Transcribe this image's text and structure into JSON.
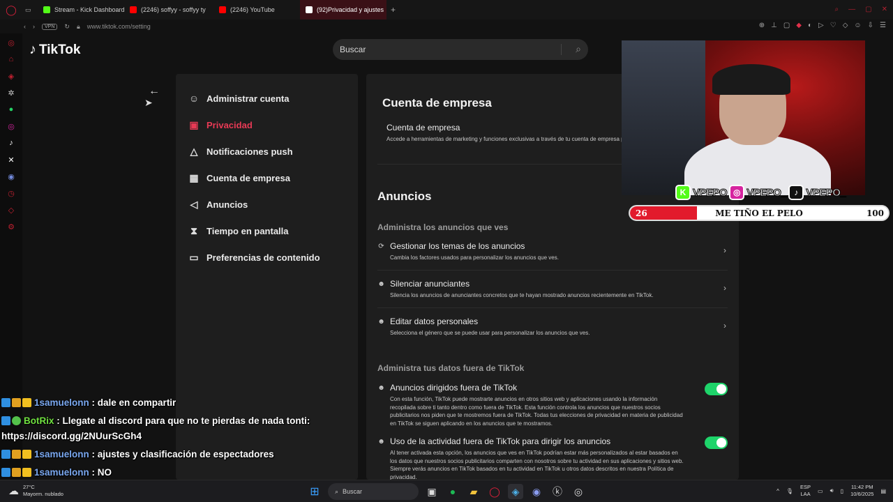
{
  "browser": {
    "tabs": [
      {
        "label": "Stream - Kick Dashboard",
        "color": "#53fc18",
        "active": false
      },
      {
        "label": "(2246) soffyy - soffyy ty",
        "color": "#ff0000",
        "active": false
      },
      {
        "label": "(2246) YouTube",
        "color": "#ff0000",
        "active": false
      },
      {
        "label": "(92)Privacidad y ajustes",
        "color": "#ffffff",
        "active": true
      }
    ],
    "new_tab": "+",
    "vpn_label": "VPN",
    "url": "www.tiktok.com/setting"
  },
  "tiktok": {
    "logo": "TikTok",
    "search_placeholder": "Buscar",
    "menu": [
      {
        "label": "Administrar cuenta",
        "icon": "user-icon",
        "glyph": "☺",
        "active": false
      },
      {
        "label": "Privacidad",
        "icon": "lock-icon",
        "glyph": "▣",
        "active": true
      },
      {
        "label": "Notificaciones push",
        "icon": "bell-icon",
        "glyph": "△",
        "active": false
      },
      {
        "label": "Cuenta de empresa",
        "icon": "store-icon",
        "glyph": "▦",
        "active": false
      },
      {
        "label": "Anuncios",
        "icon": "megaphone-icon",
        "glyph": "◁",
        "active": false
      },
      {
        "label": "Tiempo en pantalla",
        "icon": "hourglass-icon",
        "glyph": "⧗",
        "active": false
      },
      {
        "label": "Preferencias de contenido",
        "icon": "video-icon",
        "glyph": "▭",
        "active": false
      }
    ],
    "business": {
      "title": "Cuenta de empresa",
      "item_title": "Cuenta de empresa",
      "item_desc": "Accede a herramientas de marketing y funciones exclusivas a través de tu cuenta de empresa para conectar mejor con los espectadores."
    },
    "ads": {
      "title": "Anuncios",
      "section1": "Administra los anuncios que ves",
      "items": [
        {
          "title": "Gestionar los temas de los anuncios",
          "desc": "Cambia los factores usados para personalizar los anuncios que ves."
        },
        {
          "title": "Silenciar anunciantes",
          "desc": "Silencia los anuncios de anunciantes concretos que te hayan mostrado anuncios recientemente en TikTok."
        },
        {
          "title": "Editar datos personales",
          "desc": "Selecciona el género que se puede usar para personalizar los anuncios que ves."
        }
      ],
      "section2": "Administra tus datos fuera de TikTok",
      "toggles": [
        {
          "title": "Anuncios dirigidos fuera de TikTok",
          "desc": "Con esta función, TikTok puede mostrarte anuncios en otros sitios web y aplicaciones usando la información recopilada sobre ti tanto dentro como fuera de TikTok. Esta función controla los anuncios que nuestros socios publicitarios nos piden que te mostremos fuera de TikTok. Todas tus elecciones de privacidad en materia de publicidad en TikTok se siguen aplicando en los anuncios que te mostramos.",
          "on": true
        },
        {
          "title": "Uso de la actividad fuera de TikTok para dirigir los anuncios",
          "desc": "Al tener activada esta opción, los anuncios que ves en TikTok podrían estar más personalizados al estar basados en los datos que nuestros socios publicitarios comparten con nosotros sobre tu actividad en sus aplicaciones y sitios web. Siempre verás anuncios en TikTok basados en tu actividad en TikTok u otros datos descritos en nuestra Política de privacidad.",
          "on": true
        }
      ]
    }
  },
  "stream": {
    "socials": [
      {
        "icon": "kick-icon",
        "glyph": "K",
        "color": "#53fc18",
        "name": "VPEPO"
      },
      {
        "icon": "instagram-icon",
        "glyph": "◎",
        "color": "#d6249f",
        "name": "VPEPO_"
      },
      {
        "icon": "tiktok-icon",
        "glyph": "♪",
        "color": "#111111",
        "name": "VPEPO_"
      }
    ],
    "goal": {
      "label": "ME TIÑO EL PELO",
      "current": "26",
      "target": "100",
      "progress": 0.26
    }
  },
  "chat": [
    {
      "user": "1samuelonn",
      "text": " : dale en compartir",
      "style": "user-a",
      "badges": [
        "b1",
        "b2",
        "b3"
      ]
    },
    {
      "user": "BotRix",
      "text": " : Llegate al discord para que no te pierdas de nada tonti:",
      "style": "user-b",
      "badges": [
        "b1",
        "b4"
      ]
    },
    {
      "user": "",
      "text": "https://discord.gg/2NUurScGh4",
      "style": "",
      "badges": []
    },
    {
      "user": "1samuelonn",
      "text": " : ajustes y clasificación de espectadores",
      "style": "user-a",
      "badges": [
        "b1",
        "b2",
        "b3"
      ]
    },
    {
      "user": "1samuelonn",
      "text": " : NO",
      "style": "user-a",
      "badges": [
        "b1",
        "b2",
        "b3"
      ]
    }
  ],
  "taskbar": {
    "temp": "27°C",
    "weather": "Mayorm. nublado",
    "search": "Buscar",
    "lang1": "ESP",
    "lang2": "LAA",
    "time": "11:42 PM",
    "date": "10/6/2025"
  },
  "colors": {
    "accent": "#e83a55",
    "toggle": "#1ed46a"
  }
}
